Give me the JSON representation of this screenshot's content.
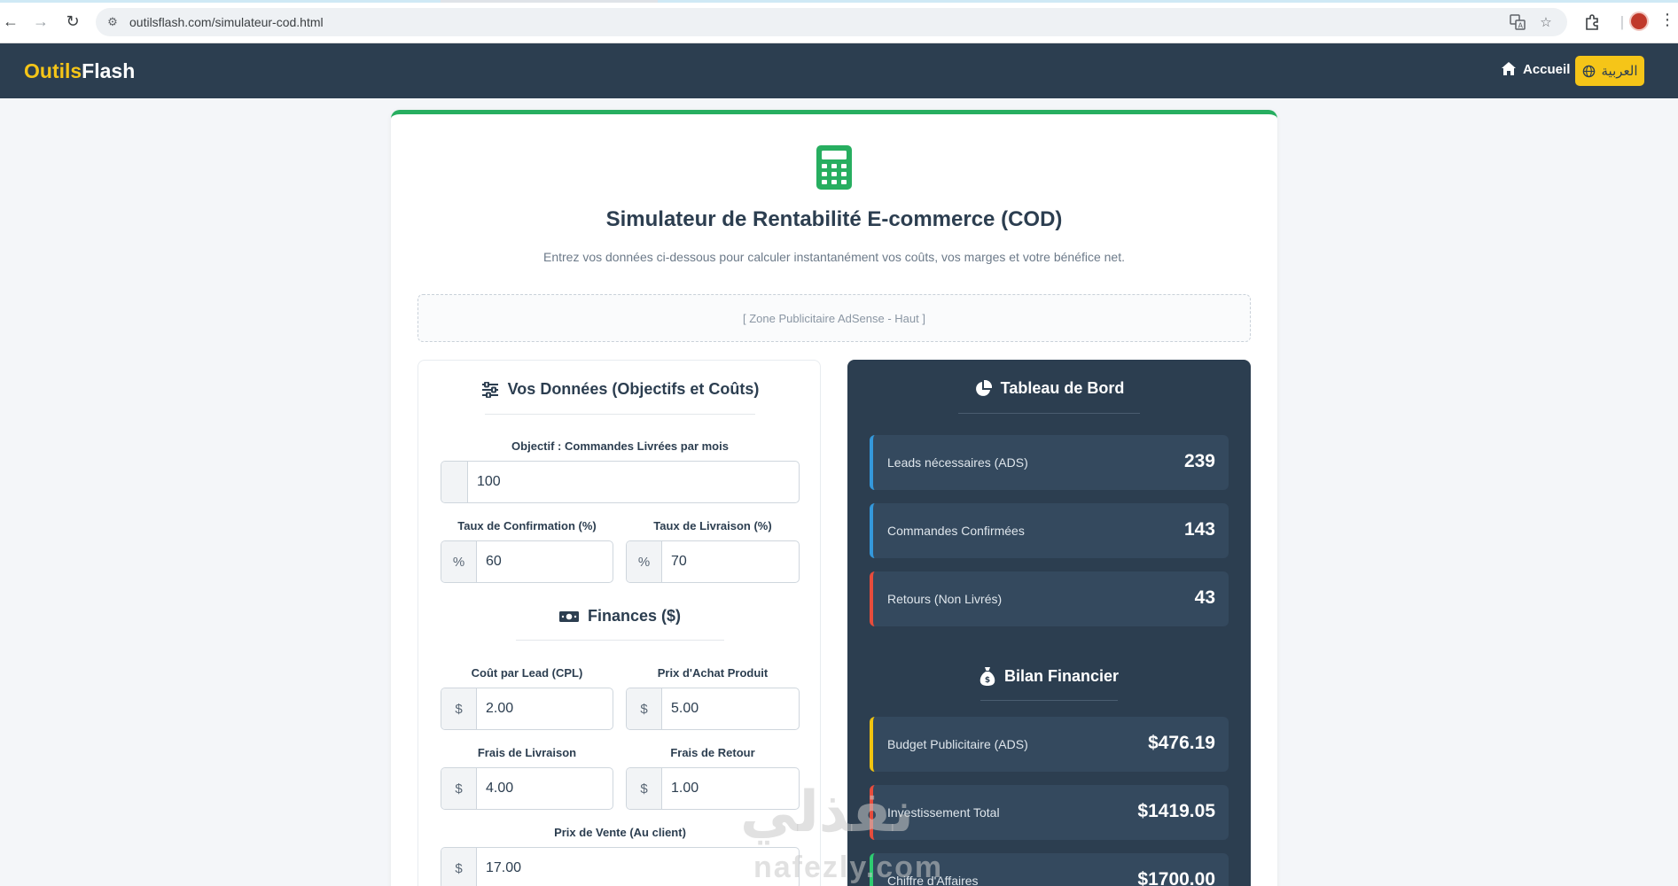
{
  "browser": {
    "url": "outilsflash.com/simulateur-cod.html"
  },
  "navbar": {
    "brand_part1": "Outils",
    "brand_part2": "Flash",
    "home_label": "Accueil",
    "lang_label": "العربية"
  },
  "page": {
    "title": "Simulateur de Rentabilité E-commerce (COD)",
    "subtitle": "Entrez vos données ci-dessous pour calculer instantanément vos coûts, vos marges et votre bénéfice net.",
    "ad_zone": "[ Zone Publicitaire AdSense - Haut ]"
  },
  "inputs_section": {
    "title": "Vos Données (Objectifs et Coûts)",
    "orders_label": "Objectif : Commandes Livrées par mois",
    "orders_value": "100",
    "confirmation_label": "Taux de Confirmation (%)",
    "confirmation_prefix": "%",
    "confirmation_value": "60",
    "delivery_rate_label": "Taux de Livraison (%)",
    "delivery_rate_prefix": "%",
    "delivery_rate_value": "70"
  },
  "finances_section": {
    "title": "Finances ($)",
    "currency": "$",
    "cpl_label": "Coût par Lead (CPL)",
    "cpl_value": "2.00",
    "purchase_label": "Prix d'Achat Produit",
    "purchase_value": "5.00",
    "shipping_label": "Frais de Livraison",
    "shipping_value": "4.00",
    "return_label": "Frais de Retour",
    "return_value": "1.00",
    "sale_label": "Prix de Vente (Au client)",
    "sale_value": "17.00"
  },
  "dashboard": {
    "title": "Tableau de Bord",
    "stats": [
      {
        "label": "Leads nécessaires (ADS)",
        "value": "239",
        "color": "#3498db"
      },
      {
        "label": "Commandes Confirmées",
        "value": "143",
        "color": "#3498db"
      },
      {
        "label": "Retours (Non Livrés)",
        "value": "43",
        "color": "#e74c3c"
      }
    ],
    "financial_title": "Bilan Financier",
    "financial": [
      {
        "label": "Budget Publicitaire (ADS)",
        "value": "$476.19",
        "color": "#f1c40f"
      },
      {
        "label": "Investissement Total",
        "value": "$1419.05",
        "color": "#e74c3c"
      },
      {
        "label": "Chiffre d'Affaires",
        "value": "$1700.00",
        "color": "#2ecc71"
      }
    ]
  },
  "watermark": {
    "arabic": "نفذلي",
    "latin": "nafezly.com"
  }
}
